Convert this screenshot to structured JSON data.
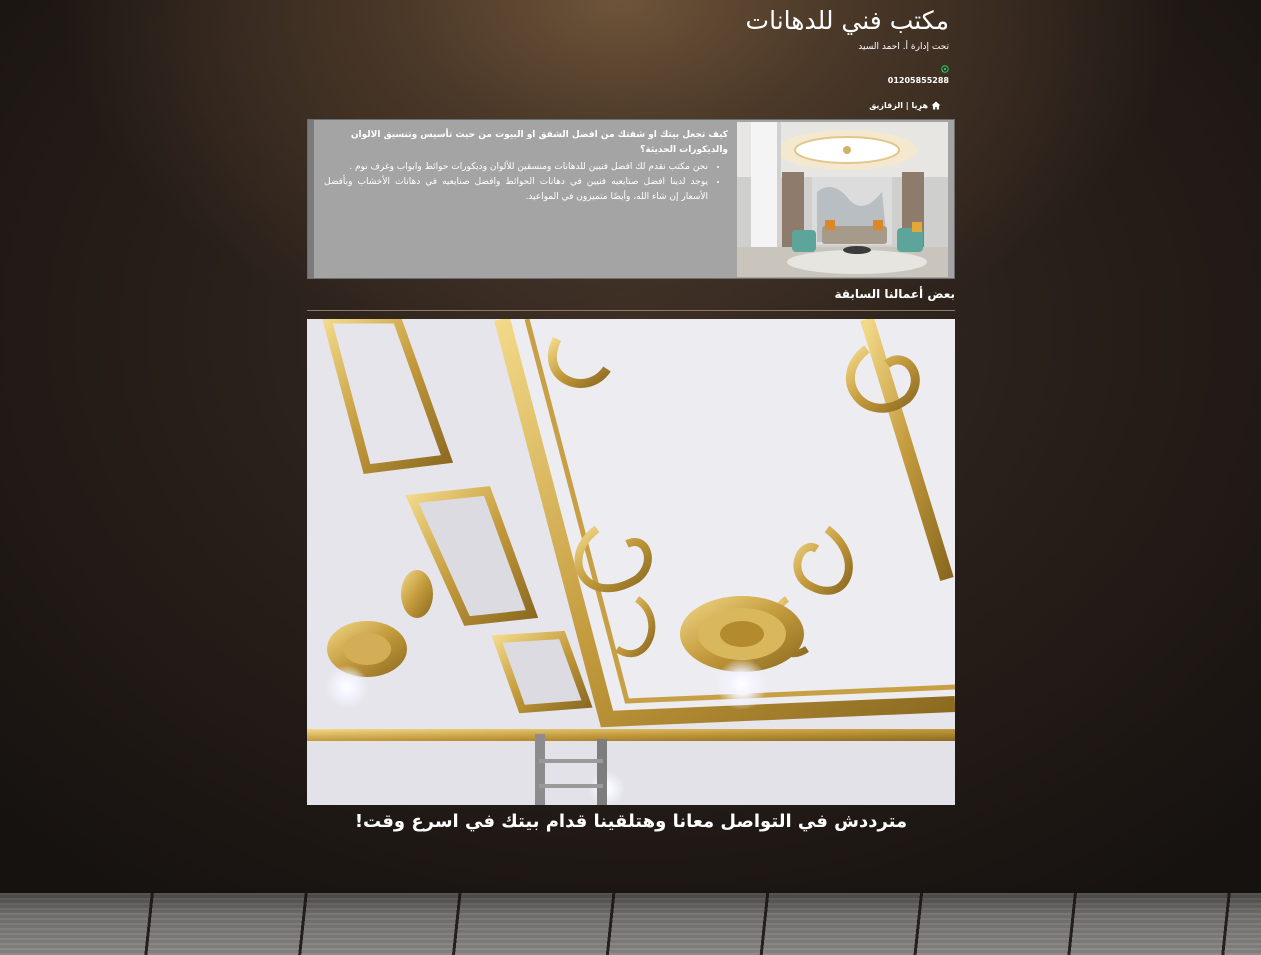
{
  "header": {
    "title": "مكتب فني للدهانات",
    "subtitle": "تحت إدارة أ. احمد السيد",
    "whatsapp_icon": "whatsapp-icon",
    "phone": "01205855288",
    "location_icon": "home-icon",
    "location": "هرِيا | الزقازيق"
  },
  "info": {
    "question": "كيف تجعل بيتك او شقتك من افضل الشقق او البيوت من حيث تأسيس وتنسيق الالوان والديكورات الحديثة؟",
    "points": [
      "نحن مكتب نقدم لك افضل فنيين للدهانات ومنسقين للألوان وديكورات حوائط وابواب وغرف نوم .",
      "يوجد لدينا افضل صنايعيه فنيين في دهانات الحوائط وافضل صنايعيه في دهانات الأخشاب وبأفضل الأسعار إن شاء الله، وأيضًا متميزون في المواعيد."
    ],
    "image_alt": "living-room-decor-photo"
  },
  "works": {
    "title": "بعض أعمالنا السابقة",
    "image_alt": "gold-ornamental-ceiling-photo"
  },
  "cta": {
    "text": "مترددش في التواصل معانا وهتلقينا قدام بيتك في اسرع وقت!"
  },
  "colors": {
    "panel_bg": "#a4a4a4",
    "whatsapp_green": "#25d366",
    "gold": "#c9a541"
  }
}
